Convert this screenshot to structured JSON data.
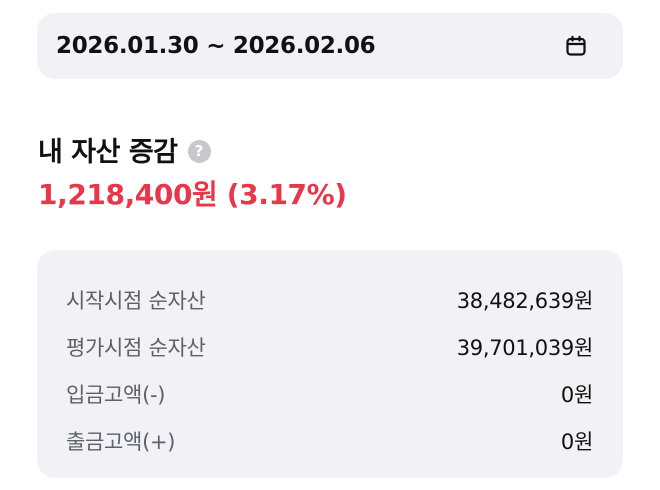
{
  "date_range": {
    "label": "2026.01.30 ~ 2026.02.06",
    "icon": "calendar-icon"
  },
  "asset_change": {
    "title": "내 자산 증감",
    "help_icon": "question-icon",
    "help_glyph": "?",
    "value": "1,218,400원 (3.17%)",
    "value_color": "#e8374a"
  },
  "summary": {
    "rows": [
      {
        "label": "시작시점 순자산",
        "value": "38,482,639원"
      },
      {
        "label": "평가시점 순자산",
        "value": "39,701,039원"
      },
      {
        "label": "입금고액(-)",
        "value": "0원"
      },
      {
        "label": "출금고액(+)",
        "value": "0원"
      }
    ]
  }
}
